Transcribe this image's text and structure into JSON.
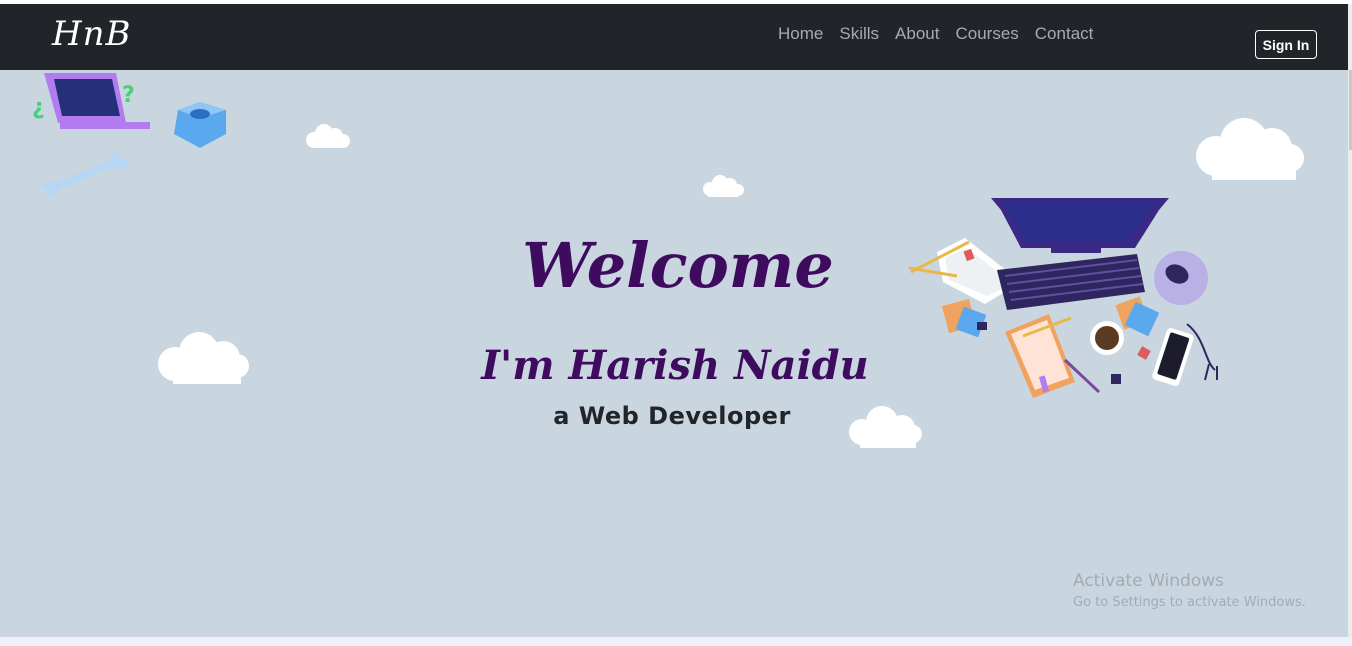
{
  "navbar": {
    "brand": "HnB",
    "links": [
      "Home",
      "Skills",
      "About",
      "Courses",
      "Contact"
    ],
    "signin_label": "Sign In"
  },
  "hero": {
    "welcome": "Welcome",
    "name": "I'm Harish Naidu",
    "role": "a Web Developer"
  },
  "watermark": {
    "title": "Activate Windows",
    "subtitle": "Go to Settings to activate Windows."
  },
  "colors": {
    "navbar_bg": "#212529",
    "hero_bg": "#c9d6e0",
    "heading": "#3f0b5f",
    "nav_link": "#a7abaf"
  },
  "icons": [
    "laptop-illustration",
    "hex-nut-illustration",
    "wrench-illustration",
    "workspace-illustration",
    "cloud-icon"
  ]
}
